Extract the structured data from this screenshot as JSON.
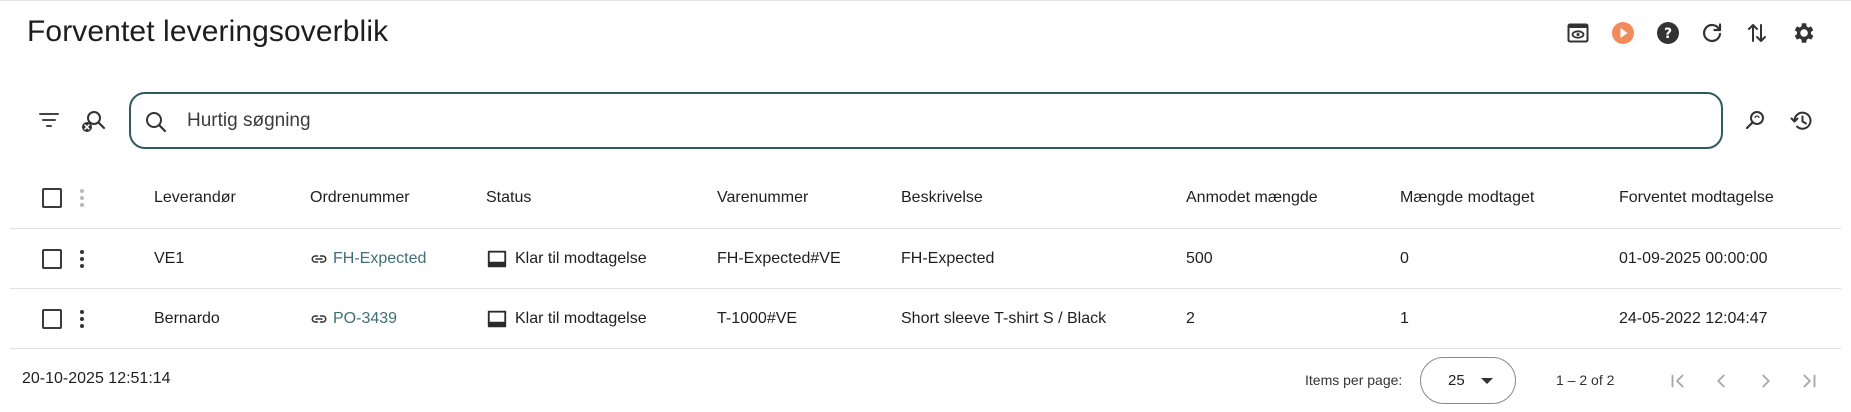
{
  "page": {
    "title": "Forventet leveringsoverblik"
  },
  "toolbar": {
    "icons": [
      "eye-window-icon",
      "play-icon",
      "help-icon",
      "refresh-icon",
      "sort-arrows-icon",
      "settings-icon"
    ],
    "accent_color": "#f28b5a"
  },
  "search": {
    "placeholder": "Hurtig søgning",
    "value": "",
    "border_color": "#2f5a5e"
  },
  "table": {
    "columns": [
      "Leverandør",
      "Ordrenummer",
      "Status",
      "Varenummer",
      "Beskrivelse",
      "Anmodet mængde",
      "Mængde modtaget",
      "Forventet modtagelse"
    ],
    "rows": [
      {
        "supplier": "VE1",
        "order": "FH-Expected",
        "status": "Klar til modtagelse",
        "item": "FH-Expected#VE",
        "description": "FH-Expected",
        "requested": "500",
        "received": "0",
        "expected": "01-09-2025 00:00:00"
      },
      {
        "supplier": "Bernardo",
        "order": "PO-3439",
        "status": "Klar til modtagelse",
        "item": "T-1000#VE",
        "description": "Short sleeve T-shirt S / Black",
        "requested": "2",
        "received": "1",
        "expected": "24-05-2022 12:04:47"
      }
    ],
    "link_color": "#3f6f73"
  },
  "footer": {
    "timestamp": "20-10-2025 12:51:14",
    "items_per_page_label": "Items per page:",
    "items_per_page": "25",
    "range": "1 – 2 of 2"
  }
}
